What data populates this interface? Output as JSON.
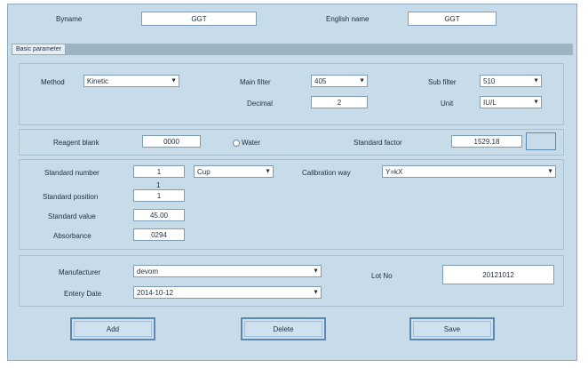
{
  "header": {
    "byname_label": "Byname",
    "byname_value": "GGT",
    "english_label": "English name",
    "english_value": "GGT"
  },
  "tabs": {
    "active": "Basic parameter"
  },
  "method_section": {
    "method_label": "Method",
    "method_value": "Kinetic",
    "main_filter_label": "Main filter",
    "main_filter_value": "405",
    "sub_filter_label": "Sub filter",
    "sub_filter_value": "510",
    "decimal_label": "Decimal",
    "decimal_value": "2",
    "unit_label": "Unit",
    "unit_value": "IU/L"
  },
  "reagent_section": {
    "reagent_blank_label": "Reagent blank",
    "reagent_blank_value": "0000",
    "water_label": "Water",
    "standard_factor_label": "Standard factor",
    "standard_factor_value": "1529.18"
  },
  "standard_section": {
    "standard_number_label": "Standard number",
    "standard_number_value": "1",
    "standard_number_unit": "Cup",
    "standard_index": "1",
    "calibration_way_label": "Calibration way",
    "calibration_way_value": "Y=kX",
    "standard_position_label": "Standard position",
    "standard_position_value": "1",
    "standard_value_label": "Standard value",
    "standard_value_value": "45.00",
    "absorbance_label": "Absorbance",
    "absorbance_value": "0294"
  },
  "manufacturer_section": {
    "manufacturer_label": "Manufacturer",
    "manufacturer_value": "devom",
    "entry_date_label": "Entery Date",
    "entry_date_value": "2014-10-12",
    "lot_no_label": "Lot No",
    "lot_no_value": "20121012"
  },
  "buttons": {
    "add": "Add",
    "delete": "Delete",
    "save": "Save"
  },
  "colors": {
    "background": "#c8dbe9",
    "field": "#ffffff",
    "border": "#7f9db5",
    "button_border": "#5a87b3"
  }
}
